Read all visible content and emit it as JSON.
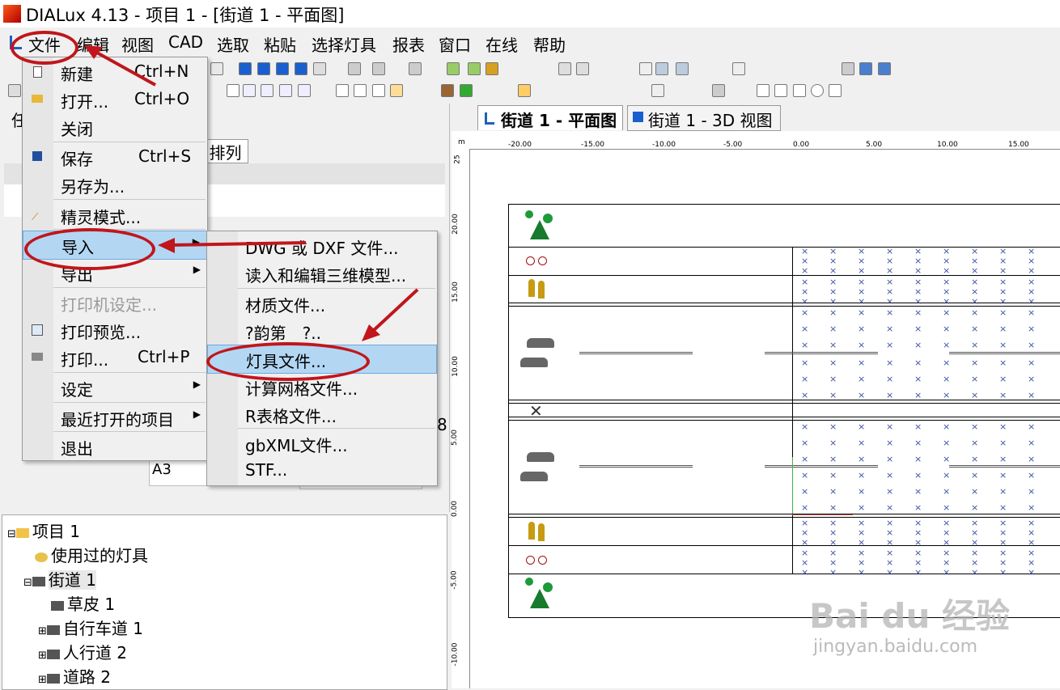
{
  "window": {
    "title": "DIALux 4.13 - 项目 1 - [街道 1 - 平面图]"
  },
  "menubar": [
    "文件",
    "编辑",
    "视图",
    "CAD",
    "选取",
    "粘贴",
    "选择灯具",
    "报表",
    "窗口",
    "在线",
    "帮助"
  ],
  "file_menu": [
    {
      "label": "新建",
      "shortcut": "Ctrl+N"
    },
    {
      "label": "打开...",
      "shortcut": "Ctrl+O"
    },
    {
      "label": "关闭",
      "shortcut": ""
    },
    {
      "label": "保存",
      "shortcut": "Ctrl+S"
    },
    {
      "label": "另存为...",
      "shortcut": ""
    },
    {
      "label": "精灵模式...",
      "shortcut": ""
    },
    {
      "label": "导入",
      "shortcut": ""
    },
    {
      "label": "导出",
      "shortcut": ""
    },
    {
      "label": "打印机设定...",
      "shortcut": ""
    },
    {
      "label": "打印预览...",
      "shortcut": ""
    },
    {
      "label": "打印...",
      "shortcut": "Ctrl+P"
    },
    {
      "label": "设定",
      "shortcut": ""
    },
    {
      "label": "最近打开的项目",
      "shortcut": ""
    },
    {
      "label": "退出",
      "shortcut": ""
    }
  ],
  "import_menu": [
    "DWG 或 DXF 文件...",
    "读入和编辑三维模型...",
    "材质文件...",
    "?韵第　?..",
    "灯具文件...",
    "计算网格文件...",
    "R表格文件...",
    "gbXML文件...",
    "STF..."
  ],
  "left_panel": {
    "tab_label": "排列",
    "paper_value": "A3",
    "partial_digit": "8",
    "side_label": "任"
  },
  "tree": [
    "项目 1",
    "使用过的灯具",
    "街道 1",
    "草皮 1",
    "自行车道 1",
    "人行道 2",
    "道路 2"
  ],
  "tabs": [
    "街道 1 - 平面图",
    "街道 1 - 3D 视图"
  ],
  "ruler": {
    "unit": "m",
    "x_labels": [
      "-20.00",
      "-15.00",
      "-10.00",
      "-5.00",
      "0.00",
      "5.00",
      "10.00",
      "15.00"
    ],
    "y_labels": [
      "25",
      "20.00",
      "15.00",
      "10.00",
      "5.00",
      "0.00",
      "-5.00",
      "-10.00"
    ]
  },
  "watermark": {
    "brand": "Bai du 经验",
    "url": "jingyan.baidu.com"
  },
  "colors": {
    "annotation": "#c0161c",
    "highlight": "#b3d7f3",
    "grid_x": "#3a4fa0"
  }
}
